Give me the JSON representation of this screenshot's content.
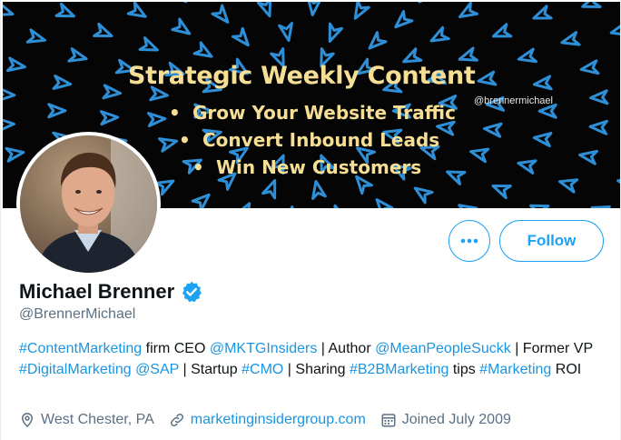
{
  "banner": {
    "headline": "Strategic Weekly Content",
    "handle": "@brennermichael",
    "bullets": [
      {
        "dot": "•",
        "text": "Grow Your Website Traffic"
      },
      {
        "dot": "•",
        "text": "Convert Inbound Leads"
      },
      {
        "dot": "•",
        "text": "Win New Customers"
      }
    ],
    "arrow_color": "#2f8fd6",
    "text_color": "#f6df95"
  },
  "profile": {
    "display_name": "Michael Brenner",
    "handle": "@BrennerMichael",
    "verified": true,
    "follow_label": "Follow",
    "more_icon": "more-horizontal-icon"
  },
  "bio": {
    "segments": [
      {
        "text": "#ContentMarketing",
        "link": true
      },
      {
        "text": " firm CEO ",
        "link": false
      },
      {
        "text": "@MKTGInsiders",
        "link": true
      },
      {
        "text": " | Author ",
        "link": false
      },
      {
        "text": "@MeanPeopleSuckk",
        "link": true
      },
      {
        "text": " | Former VP ",
        "link": false
      },
      {
        "text": "#DigitalMarketing",
        "link": true
      },
      {
        "text": " ",
        "link": false
      },
      {
        "text": "@SAP",
        "link": true
      },
      {
        "text": " | Startup ",
        "link": false
      },
      {
        "text": "#CMO",
        "link": true
      },
      {
        "text": " | Sharing ",
        "link": false
      },
      {
        "text": "#B2BMarketing",
        "link": true
      },
      {
        "text": " tips ",
        "link": false
      },
      {
        "text": "#Marketing",
        "link": true
      },
      {
        "text": " ROI",
        "link": false
      }
    ]
  },
  "meta": {
    "location": "West Chester, PA",
    "website": "marketinginsidergroup.com",
    "joined": "Joined July 2009"
  },
  "colors": {
    "accent": "#1da1f2",
    "link": "#1b95e0",
    "secondary_text": "#5b7083"
  }
}
